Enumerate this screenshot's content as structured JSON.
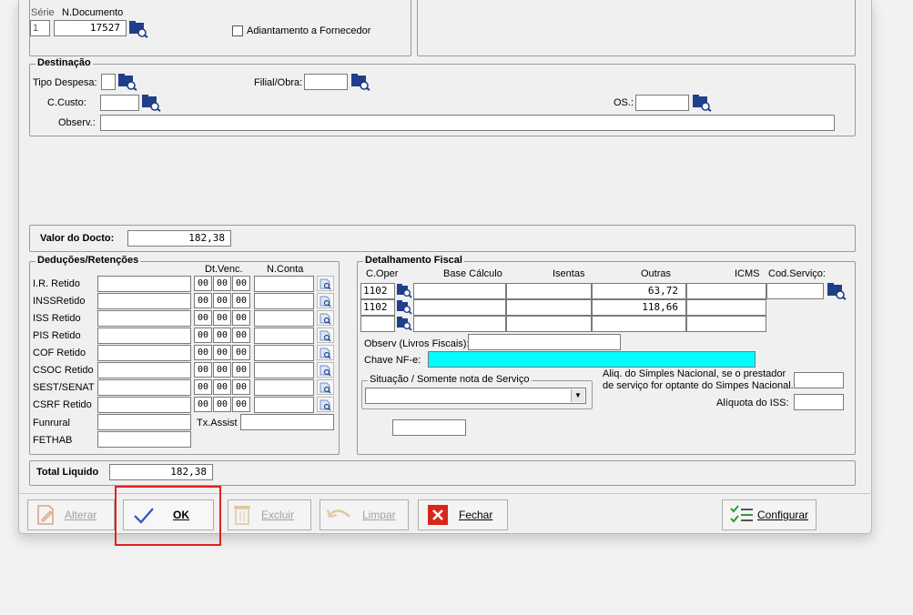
{
  "document": {
    "serie_label": "Série",
    "serie_value": "1",
    "ndocumento_label": "N.Documento",
    "ndocumento_value": "17527",
    "adiantamento_label": "Adiantamento a Fornecedor"
  },
  "destinacao": {
    "title": "Destinação",
    "tipo_despesa_label": "Tipo Despesa:",
    "filial_obra_label": "Filial/Obra:",
    "ccusto_label": "C.Custo:",
    "os_label": "OS.:",
    "observ_label": "Observ.:"
  },
  "valor_docto": {
    "label": "Valor do Docto:",
    "value": "182,38"
  },
  "deducoes": {
    "title": "Deduções/Retenções",
    "dt_venc_header": "Dt.Venc.",
    "nconta_header": "N.Conta",
    "rows": [
      {
        "label": "I.R. Retido",
        "d": "00",
        "m": "00",
        "y": "00"
      },
      {
        "label": "INSSRetido",
        "d": "00",
        "m": "00",
        "y": "00"
      },
      {
        "label": "ISS Retido",
        "d": "00",
        "m": "00",
        "y": "00"
      },
      {
        "label": "PIS Retido",
        "d": "00",
        "m": "00",
        "y": "00"
      },
      {
        "label": "COF Retido",
        "d": "00",
        "m": "00",
        "y": "00"
      },
      {
        "label": "CSOC Retido",
        "d": "00",
        "m": "00",
        "y": "00"
      },
      {
        "label": "SEST/SENAT",
        "d": "00",
        "m": "00",
        "y": "00"
      },
      {
        "label": "CSRF Retido",
        "d": "00",
        "m": "00",
        "y": "00"
      }
    ],
    "funrural_label": "Funrural",
    "fethab_label": "FETHAB",
    "tx_assist_label": "Tx.Assist"
  },
  "fiscal": {
    "title": "Detalhamento Fiscal",
    "headers": {
      "coper": "C.Oper",
      "base": "Base Cálculo",
      "isentas": "Isentas",
      "outras": "Outras",
      "icms": "ICMS",
      "codservico": "Cod.Serviço:"
    },
    "rows": [
      {
        "coper": "1102",
        "outras": "63,72"
      },
      {
        "coper": "1102",
        "outras": "118,66"
      },
      {
        "coper": "",
        "outras": ""
      }
    ],
    "observ_livros_label": "Observ (Livros Fiscais):",
    "chave_nfe_label": "Chave NF-e:",
    "situacao_title": "Situação / Somente nota de Serviço",
    "aliq_simples_label_1": "Aliq. do Simples Nacional, se o prestador",
    "aliq_simples_label_2": "de serviço for optante do Simpes Nacional.",
    "aliquota_iss_label": "Alíquota do ISS:",
    "chave_color": "#00ffff"
  },
  "total": {
    "label": "Total Liquido",
    "value": "182,38"
  },
  "buttons": {
    "alterar": "Alterar",
    "ok": "OK",
    "excluir": "Excluir",
    "limpar": "Limpar",
    "fechar": "Fechar",
    "configurar": "Configurar"
  },
  "colors": {
    "highlight": "#e02020",
    "ok_check": "#2b54c8",
    "fechar_red": "#d9261c",
    "configurar_green": "#2e9b3a"
  }
}
